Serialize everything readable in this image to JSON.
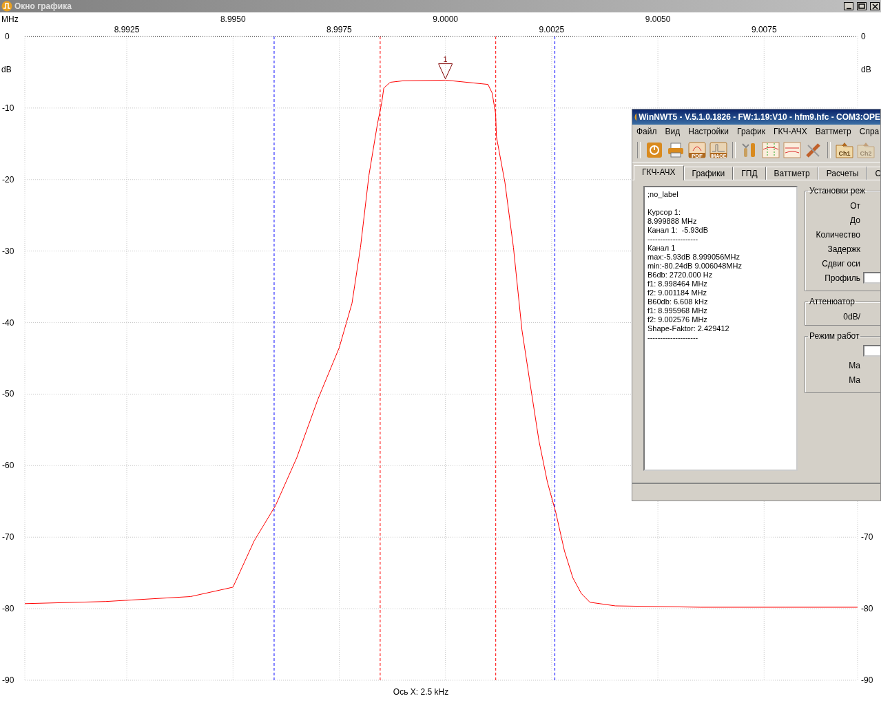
{
  "window": {
    "title": "Окно графика"
  },
  "chart": {
    "unit_x": "MHz",
    "upper_x_labels": [
      "8.9950",
      "9.0000",
      "9.0050"
    ],
    "unit_y_left": "dB",
    "unit_y_right": "dB",
    "right_axis_labels": [
      "0",
      "-70",
      "-80",
      "-90"
    ],
    "chart_data": {
      "type": "line",
      "grid": true,
      "xlabel": "Ось X: 2.5 kHz",
      "xlim": [
        8.9901,
        9.0097
      ],
      "ylim": [
        -90,
        0
      ],
      "xticks": [
        {
          "value": 8.9925,
          "label": "8.9925"
        },
        {
          "value": 8.9975,
          "label": "8.9975"
        },
        {
          "value": 9.0025,
          "label": "9.0025"
        },
        {
          "value": 9.0075,
          "label": "9.0075"
        }
      ],
      "yticks": [
        0,
        -10,
        -20,
        -30,
        -40,
        -50,
        -60,
        -70,
        -80,
        -90
      ],
      "x": [
        8.9901,
        8.992,
        8.994,
        8.995,
        8.9955,
        8.996,
        8.9965,
        8.997,
        8.9975,
        8.9978,
        8.998,
        8.9982,
        8.9984,
        8.9985,
        8.99855,
        8.9987,
        8.999,
        9.0,
        9.001,
        9.0011,
        9.00118,
        9.0012,
        9.0014,
        9.0016,
        9.0018,
        9.002,
        9.0022,
        9.0024,
        9.0026,
        9.0028,
        9.003,
        9.0032,
        9.0034,
        9.004,
        9.006,
        9.008,
        9.0097
      ],
      "series": [
        {
          "color": "#ff0000",
          "values": [
            -79.3,
            -79,
            -78.3,
            -77,
            -70.5,
            -65.6,
            -58.9,
            -50.7,
            -43.5,
            -37.3,
            -29.5,
            -19.4,
            -12.2,
            -9.3,
            -7.2,
            -6.4,
            -6.2,
            -6.1,
            -6.7,
            -7.9,
            -10.8,
            -14,
            -20.4,
            -29.5,
            -41,
            -48.8,
            -56.5,
            -62.3,
            -66.6,
            -71.9,
            -75.7,
            -77.9,
            -79.1,
            -79.6,
            -79.8,
            -79.8,
            -79.8
          ]
        }
      ],
      "ref_lines": [
        {
          "axis": "x",
          "value": 8.995968,
          "color": "#0000ff"
        },
        {
          "axis": "x",
          "value": 8.998464,
          "color": "#ff0000"
        },
        {
          "axis": "x",
          "value": 9.001184,
          "color": "#ff0000"
        },
        {
          "axis": "x",
          "value": 9.002576,
          "color": "#0000ff"
        }
      ],
      "annotations": [
        {
          "x": 9.0,
          "y": -5.93,
          "text": "1"
        }
      ]
    }
  },
  "dialog": {
    "title": "WinNWT5 - V.5.1.0.1826 - FW:1.19:V10 - hfm9.hfc - COM3:OPE",
    "menu": [
      "Файл",
      "Вид",
      "Настройки",
      "График",
      "ГКЧ-АЧХ",
      "Ваттметр",
      "Спра"
    ],
    "toolbar": [
      {
        "kind": "power",
        "disabled": false
      },
      {
        "kind": "printer",
        "disabled": false
      },
      {
        "kind": "pdf",
        "label": "PDF",
        "disabled": false
      },
      {
        "kind": "image",
        "label": "IMAGE",
        "disabled": false
      },
      {
        "kind": "tools",
        "disabled": false
      },
      {
        "kind": "cursor",
        "disabled": false
      },
      {
        "kind": "db",
        "disabled": false
      },
      {
        "kind": "multitool",
        "disabled": false
      },
      {
        "kind": "folder",
        "label": "Ch1",
        "disabled": false
      },
      {
        "kind": "folder",
        "label": "Ch2",
        "disabled": true
      }
    ],
    "tabs": [
      {
        "label": "ГКЧ-АЧХ",
        "selected": true
      },
      {
        "label": "Графики",
        "selected": false
      },
      {
        "label": "ГПД",
        "selected": false
      },
      {
        "label": "Ваттметр",
        "selected": false
      },
      {
        "label": "Расчеты",
        "selected": false
      },
      {
        "label": "С",
        "selected": false
      }
    ],
    "info_lines": [
      ";no_label",
      "Курсор 1:",
      "8.999888 MHz",
      "Канал 1:  -5.93dB",
      "--------------------",
      "Канал 1",
      "max:-5.93dB 8.999056MHz",
      "min:-80.24dB 9.006048MHz",
      "B6db: 2720.000 Hz",
      "f1: 8.998464 MHz",
      "f2: 9.001184 MHz",
      "B60db: 6.608 kHz",
      "f1: 8.995968 MHz",
      "f2: 9.002576 MHz",
      "Shape-Faktor: 2.429412",
      "--------------------"
    ],
    "groups": [
      {
        "title": "Установки реж",
        "rows": [
          {
            "kind": "label",
            "text": "От"
          },
          {
            "kind": "label",
            "text": "До"
          },
          {
            "kind": "label",
            "text": "Количество"
          },
          {
            "kind": "label",
            "text": "Задержк"
          },
          {
            "kind": "label",
            "text": "Сдвиг оси"
          },
          {
            "kind": "label_field",
            "text": "Профиль"
          }
        ]
      },
      {
        "title": "Аттенюатор",
        "rows": [
          {
            "kind": "label",
            "text": "0dB/"
          }
        ]
      },
      {
        "title": "Режим работ",
        "rows": [
          {
            "kind": "field"
          },
          {
            "kind": "label",
            "text": "Ма"
          },
          {
            "kind": "label",
            "text": "Ма"
          }
        ]
      }
    ]
  }
}
